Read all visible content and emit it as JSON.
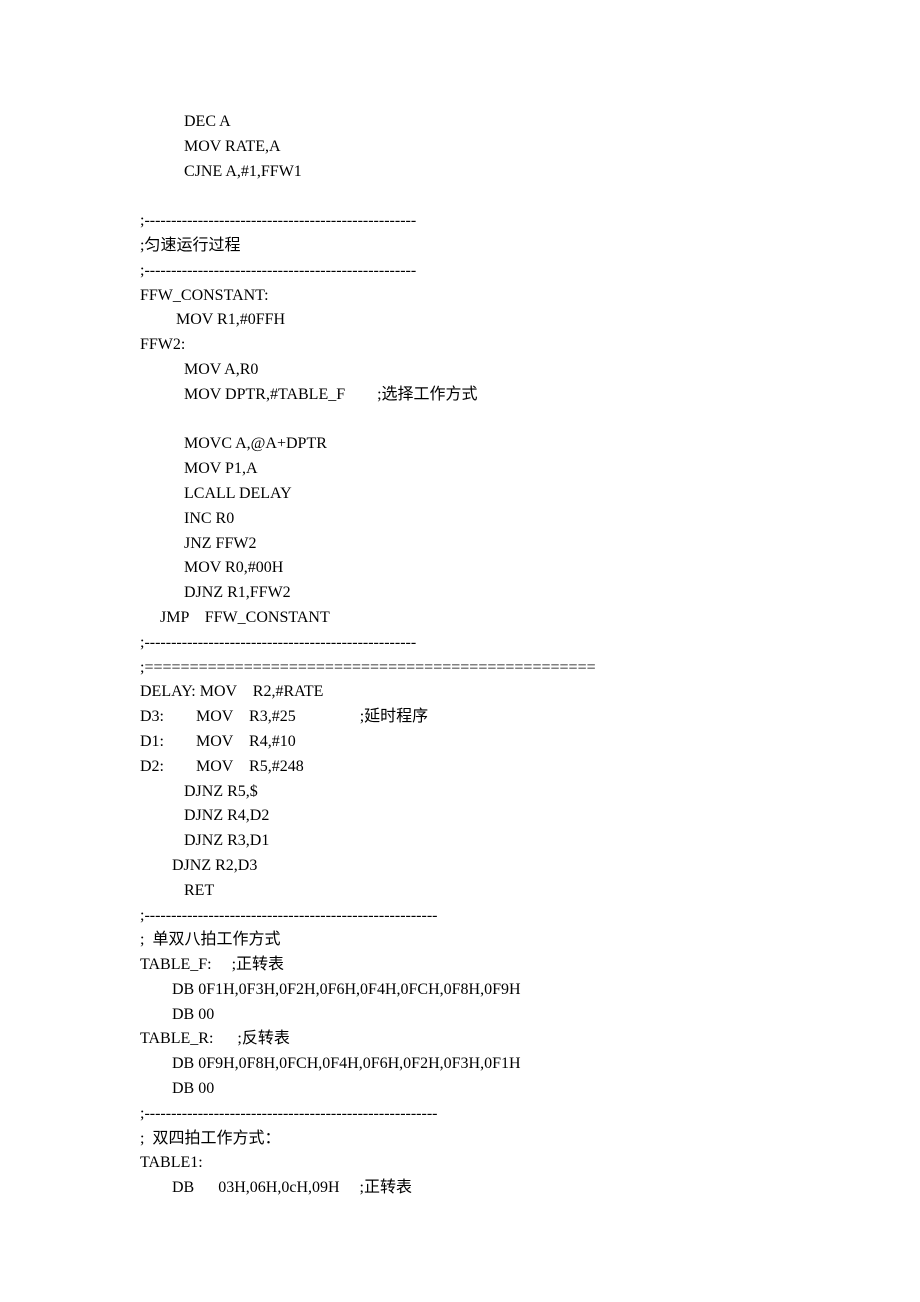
{
  "lines": [
    "           DEC A",
    "           MOV RATE,A",
    "           CJNE A,#1,FFW1",
    "",
    ";---------------------------------------------------",
    ";匀速运行过程",
    ";---------------------------------------------------",
    "FFW_CONSTANT:",
    "         MOV R1,#0FFH",
    "FFW2:",
    "           MOV A,R0",
    "           MOV DPTR,#TABLE_F        ;选择工作方式",
    "",
    "           MOVC A,@A+DPTR",
    "           MOV P1,A",
    "           LCALL DELAY",
    "           INC R0",
    "           JNZ FFW2",
    "           MOV R0,#00H",
    "           DJNZ R1,FFW2",
    "     JMP    FFW_CONSTANT",
    ";---------------------------------------------------",
    ";==================================================",
    "DELAY: MOV    R2,#RATE",
    "D3:        MOV    R3,#25                ;延时程序",
    "D1:        MOV    R4,#10",
    "D2:        MOV    R5,#248",
    "           DJNZ R5,$",
    "           DJNZ R4,D2",
    "           DJNZ R3,D1",
    "        DJNZ R2,D3",
    "           RET",
    ";-------------------------------------------------------",
    ";  单双八拍工作方式",
    "TABLE_F:     ;正转表",
    "        DB 0F1H,0F3H,0F2H,0F6H,0F4H,0FCH,0F8H,0F9H",
    "        DB 00",
    "TABLE_R:      ;反转表",
    "        DB 0F9H,0F8H,0FCH,0F4H,0F6H,0F2H,0F3H,0F1H",
    "        DB 00",
    ";-------------------------------------------------------",
    ";  双四拍工作方式：",
    "TABLE1:",
    "        DB      03H,06H,0cH,09H     ;正转表"
  ]
}
